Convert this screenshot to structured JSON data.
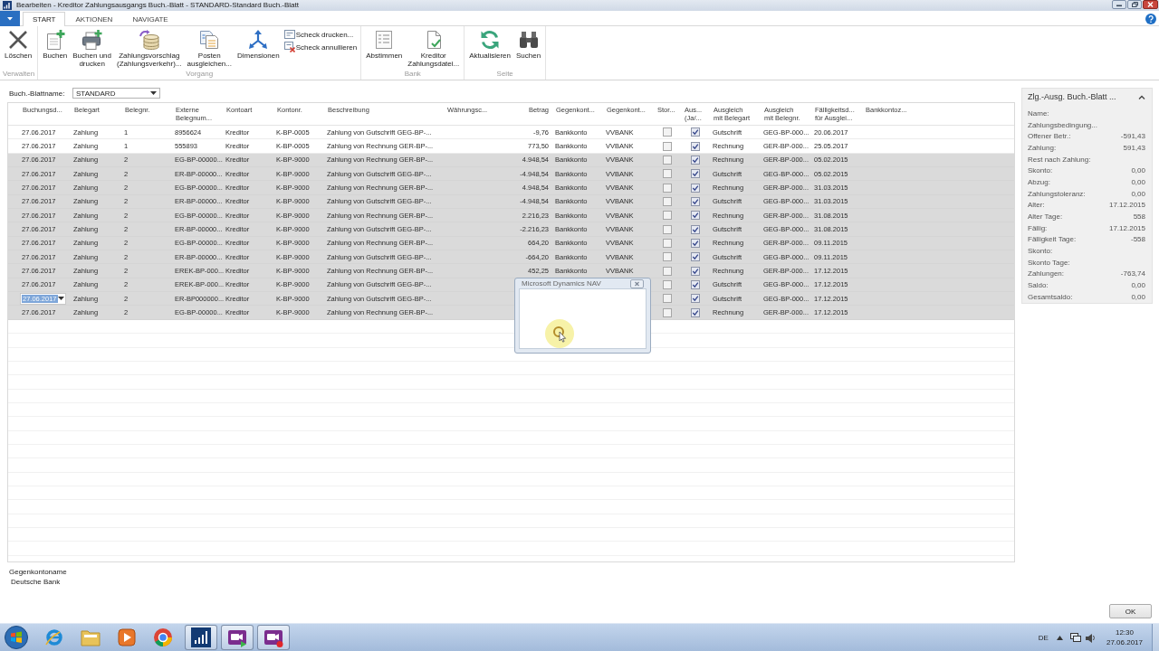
{
  "window": {
    "title": "Bearbeiten - Kreditor Zahlungsausgangs Buch.-Blatt - STANDARD-Standard Buch.-Blatt"
  },
  "tabs": [
    {
      "label": "START",
      "selected": true
    },
    {
      "label": "AKTIONEN",
      "selected": false
    },
    {
      "label": "NAVIGATE",
      "selected": false
    }
  ],
  "ribbon": {
    "groups": [
      {
        "label": "Verwalten",
        "buttons": [
          {
            "label": "Löschen",
            "kind": "large"
          }
        ]
      },
      {
        "label": "Vorgang",
        "buttons": [
          {
            "label": "Buchen",
            "kind": "large"
          },
          {
            "label": "Buchen und\ndrucken",
            "kind": "large"
          },
          {
            "label": "Zahlungsvorschlag\n(Zahlungsverkehr)...",
            "kind": "large"
          },
          {
            "label": "Posten\nausgleichen...",
            "kind": "large"
          },
          {
            "label": "Dimensionen",
            "kind": "large"
          },
          {
            "label": "Scheck drucken...",
            "kind": "small"
          },
          {
            "label": "Scheck annullieren",
            "kind": "small"
          }
        ]
      },
      {
        "label": "Bank",
        "buttons": [
          {
            "label": "Abstimmen",
            "kind": "large"
          },
          {
            "label": "Kreditor\nZahlungsdatei...",
            "kind": "large"
          }
        ]
      },
      {
        "label": "Seite",
        "buttons": [
          {
            "label": "Aktualisieren",
            "kind": "large"
          },
          {
            "label": "Suchen",
            "kind": "large"
          }
        ]
      }
    ]
  },
  "journal": {
    "label": "Buch.-Blattname:",
    "value": "STANDARD"
  },
  "table": {
    "columns": [
      {
        "label": "Buchungsd...",
        "kind": "text"
      },
      {
        "label": "Belegart",
        "kind": "text"
      },
      {
        "label": "Belegnr.",
        "kind": "text"
      },
      {
        "label": "Externe\nBelegnum...",
        "kind": "text"
      },
      {
        "label": "Kontoart",
        "kind": "text"
      },
      {
        "label": "Kontonr.",
        "kind": "text"
      },
      {
        "label": "Beschreibung",
        "kind": "text"
      },
      {
        "label": "Währungsc...",
        "kind": "text"
      },
      {
        "label": "Betrag",
        "kind": "number"
      },
      {
        "label": "Gegenkont...",
        "kind": "text"
      },
      {
        "label": "Gegenkont...",
        "kind": "text"
      },
      {
        "label": "Stor...",
        "kind": "checkbox"
      },
      {
        "label": "Aus...\n(Ja/...",
        "kind": "checkbox"
      },
      {
        "label": "Ausgleich\nmit Belegart",
        "kind": "text"
      },
      {
        "label": "Ausgleich\nmit Belegnr.",
        "kind": "text"
      },
      {
        "label": "Fälligkeitsd...\nfür Ausglei...",
        "kind": "text"
      },
      {
        "label": "Bankkontoz...",
        "kind": "text"
      }
    ],
    "rows": [
      {
        "selected": false,
        "editing": false,
        "cells": [
          "27.06.2017",
          "Zahlung",
          "1",
          "8956624",
          "Kreditor",
          "K-BP-0005",
          "Zahlung von Gutschrift GEG-BP-...",
          null,
          "-9,76",
          "Bankkonto",
          "VVBANK",
          false,
          true,
          "Gutschrift",
          "GEG-BP-000...",
          "20.06.2017"
        ]
      },
      {
        "selected": false,
        "editing": false,
        "cells": [
          "27.06.2017",
          "Zahlung",
          "1",
          "555893",
          "Kreditor",
          "K-BP-0005",
          "Zahlung von Rechnung GER-BP-...",
          null,
          "773,50",
          "Bankkonto",
          "VVBANK",
          false,
          true,
          "Rechnung",
          "GER-BP-000...",
          "25.05.2017"
        ]
      },
      {
        "selected": true,
        "editing": false,
        "cells": [
          "27.06.2017",
          "Zahlung",
          "2",
          "EG-BP-00000...",
          "Kreditor",
          "K-BP-9000",
          "Zahlung von Rechnung GER-BP-...",
          null,
          "4.948,54",
          "Bankkonto",
          "VVBANK",
          false,
          true,
          "Rechnung",
          "GER-BP-000...",
          "05.02.2015"
        ]
      },
      {
        "selected": true,
        "editing": false,
        "cells": [
          "27.06.2017",
          "Zahlung",
          "2",
          "ER-BP-00000...",
          "Kreditor",
          "K-BP-9000",
          "Zahlung von Gutschrift GEG-BP-...",
          null,
          "-4.948,54",
          "Bankkonto",
          "VVBANK",
          false,
          true,
          "Gutschrift",
          "GEG-BP-000...",
          "05.02.2015"
        ]
      },
      {
        "selected": true,
        "editing": false,
        "cells": [
          "27.06.2017",
          "Zahlung",
          "2",
          "EG-BP-00000...",
          "Kreditor",
          "K-BP-9000",
          "Zahlung von Rechnung GER-BP-...",
          null,
          "4.948,54",
          "Bankkonto",
          "VVBANK",
          false,
          true,
          "Rechnung",
          "GER-BP-000...",
          "31.03.2015"
        ]
      },
      {
        "selected": true,
        "editing": false,
        "cells": [
          "27.06.2017",
          "Zahlung",
          "2",
          "ER-BP-00000...",
          "Kreditor",
          "K-BP-9000",
          "Zahlung von Gutschrift GEG-BP-...",
          null,
          "-4.948,54",
          "Bankkonto",
          "VVBANK",
          false,
          true,
          "Gutschrift",
          "GEG-BP-000...",
          "31.03.2015"
        ]
      },
      {
        "selected": true,
        "editing": false,
        "cells": [
          "27.06.2017",
          "Zahlung",
          "2",
          "EG-BP-00000...",
          "Kreditor",
          "K-BP-9000",
          "Zahlung von Rechnung GER-BP-...",
          null,
          "2.216,23",
          "Bankkonto",
          "VVBANK",
          false,
          true,
          "Rechnung",
          "GER-BP-000...",
          "31.08.2015"
        ]
      },
      {
        "selected": true,
        "editing": false,
        "cells": [
          "27.06.2017",
          "Zahlung",
          "2",
          "ER-BP-00000...",
          "Kreditor",
          "K-BP-9000",
          "Zahlung von Gutschrift GEG-BP-...",
          null,
          "-2.216,23",
          "Bankkonto",
          "VVBANK",
          false,
          true,
          "Gutschrift",
          "GEG-BP-000...",
          "31.08.2015"
        ]
      },
      {
        "selected": true,
        "editing": false,
        "cells": [
          "27.06.2017",
          "Zahlung",
          "2",
          "EG-BP-00000...",
          "Kreditor",
          "K-BP-9000",
          "Zahlung von Rechnung GER-BP-...",
          null,
          "664,20",
          "Bankkonto",
          "VVBANK",
          false,
          true,
          "Rechnung",
          "GER-BP-000...",
          "09.11.2015"
        ]
      },
      {
        "selected": true,
        "editing": false,
        "cells": [
          "27.06.2017",
          "Zahlung",
          "2",
          "ER-BP-00000...",
          "Kreditor",
          "K-BP-9000",
          "Zahlung von Gutschrift GEG-BP-...",
          null,
          "-664,20",
          "Bankkonto",
          "VVBANK",
          false,
          true,
          "Gutschrift",
          "GEG-BP-000...",
          "09.11.2015"
        ]
      },
      {
        "selected": true,
        "editing": false,
        "cells": [
          "27.06.2017",
          "Zahlung",
          "2",
          "EREK-BP-000...",
          "Kreditor",
          "K-BP-9000",
          "Zahlung von Rechnung GER-BP-...",
          null,
          "452,25",
          "Bankkonto",
          "VVBANK",
          false,
          true,
          "Rechnung",
          "GER-BP-000...",
          "17.12.2015"
        ]
      },
      {
        "selected": true,
        "editing": false,
        "cells": [
          "27.06.2017",
          "Zahlung",
          "2",
          "EREK-BP-000...",
          "Kreditor",
          "K-BP-9000",
          "Zahlung von Gutschrift GEG-BP-...",
          null,
          null,
          null,
          null,
          false,
          true,
          "Gutschrift",
          "GEG-BP-000...",
          "17.12.2015"
        ]
      },
      {
        "selected": true,
        "editing": true,
        "cells": [
          "27.06.2017",
          "Zahlung",
          "2",
          "ER-BP000000...",
          "Kreditor",
          "K-BP-9000",
          "Zahlung von Gutschrift GEG-BP-...",
          null,
          null,
          null,
          null,
          false,
          true,
          "Gutschrift",
          "GEG-BP-000...",
          "17.12.2015"
        ]
      },
      {
        "selected": true,
        "editing": false,
        "cells": [
          "27.06.2017",
          "Zahlung",
          "2",
          "EG-BP-00000...",
          "Kreditor",
          "K-BP-9000",
          "Zahlung von Rechnung GER-BP-...",
          null,
          null,
          null,
          null,
          false,
          true,
          "Rechnung",
          "GER-BP-000...",
          "17.12.2015"
        ]
      }
    ]
  },
  "factbox": {
    "title": "Zlg.-Ausg. Buch.-Blatt ...",
    "fields": [
      {
        "label": "Name:"
      },
      {
        "label": "Zahlungsbedingung..."
      },
      {
        "label": "Offener Betr.:",
        "value": "-591,43"
      },
      {
        "label": "Zahlung:",
        "value": "591,43"
      },
      {
        "label": "Rest nach Zahlung:"
      },
      {
        "label": "Skonto:",
        "value": "0,00"
      },
      {
        "label": "Abzug:",
        "value": "0,00"
      },
      {
        "label": "Zahlungstoleranz:",
        "value": "0,00"
      },
      {
        "label": "Alter:",
        "value": "17.12.2015"
      },
      {
        "label": "Alter Tage:",
        "value": "558"
      },
      {
        "label": "Fällig:",
        "value": "17.12.2015"
      },
      {
        "label": "Fälligkeit Tage:",
        "value": "-558"
      },
      {
        "label": "Skonto:"
      },
      {
        "label": "Skonto Tage:"
      },
      {
        "label": "Zahlungen:",
        "value": "-763,74"
      },
      {
        "label": "Saldo:",
        "value": "0,00"
      },
      {
        "label": "Gesamtsaldo:",
        "value": "0,00"
      }
    ]
  },
  "details": {
    "label": "Gegenkontoname",
    "value": "Deutsche Bank"
  },
  "ok_button": "OK",
  "dialog": {
    "title": "Microsoft Dynamics NAV"
  },
  "taskbar": {
    "apps": [
      {
        "running": false
      },
      {
        "running": false
      },
      {
        "running": false
      },
      {
        "running": false
      },
      {
        "running": true
      },
      {
        "running": true
      },
      {
        "running": true
      }
    ],
    "language": "DE",
    "time": "12:30",
    "date": "27.06.2017"
  }
}
